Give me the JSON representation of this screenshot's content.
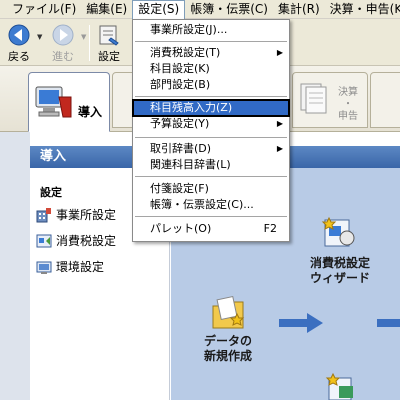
{
  "menubar": {
    "items": [
      "ファイル(F)",
      "編集(E)",
      "設定(S)",
      "帳簿・伝票(C)",
      "集計(R)",
      "決算・申告(K)"
    ]
  },
  "toolbar": {
    "back": "戻る",
    "forward": "進む",
    "settings": "設定"
  },
  "tabs": {
    "intro": "導入",
    "closing_line1": "決算",
    "closing_line2": "・",
    "closing_line3": "申告"
  },
  "main": {
    "header": "導入",
    "section_title": "設定",
    "links": [
      "事業所設定",
      "消費税設定",
      "環境設定"
    ]
  },
  "flow": {
    "wizard_line1": "消費税設定",
    "wizard_line2": "ウィザード",
    "new_data_line1": "データの",
    "new_data_line2": "新規作成"
  },
  "dropdown": {
    "items": [
      {
        "label": "事業所設定(J)...",
        "submenu": false,
        "shortcut": ""
      },
      {
        "label": "消費税設定(T)",
        "submenu": true,
        "shortcut": ""
      },
      {
        "label": "科目設定(K)",
        "submenu": false,
        "shortcut": ""
      },
      {
        "label": "部門設定(B)",
        "submenu": false,
        "shortcut": ""
      },
      {
        "label": "科目残高入力(Z)",
        "submenu": false,
        "shortcut": "",
        "highlighted": true
      },
      {
        "label": "予算設定(Y)",
        "submenu": true,
        "shortcut": ""
      },
      {
        "label": "取引辞書(D)",
        "submenu": true,
        "shortcut": ""
      },
      {
        "label": "関連科目辞書(L)",
        "submenu": false,
        "shortcut": ""
      },
      {
        "label": "付箋設定(F)",
        "submenu": false,
        "shortcut": ""
      },
      {
        "label": "帳簿・伝票設定(C)...",
        "submenu": false,
        "shortcut": ""
      },
      {
        "label": "パレット(O)",
        "submenu": false,
        "shortcut": "F2"
      }
    ]
  },
  "colors": {
    "highlight": "#316ac5",
    "header_blue": "#3a66a8",
    "flow_bg": "#b8cbe6",
    "arrow_blue": "#3b6fc0"
  }
}
